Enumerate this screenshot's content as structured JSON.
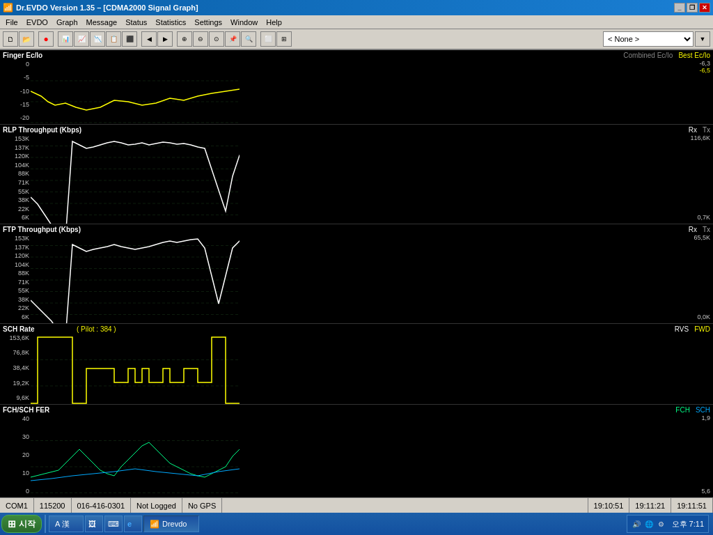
{
  "titleBar": {
    "title": "Dr.EVDO Version 1.35 – [CDMA2000 Signal Graph]",
    "icon": "📶"
  },
  "menuBar": {
    "items": [
      "File",
      "EVDO",
      "Graph",
      "Message",
      "Status",
      "Statistics",
      "Settings",
      "Window",
      "Help"
    ]
  },
  "toolbar": {
    "dropdown": {
      "label": "< None >",
      "options": [
        "< None >"
      ]
    }
  },
  "graphs": [
    {
      "id": "finger-ecio",
      "title": "Finger Ec/Io",
      "rightLabels": [
        "Combined Ec/Io",
        "Best Ec/Io"
      ],
      "yLabels": [
        "0",
        "-5",
        "-10",
        "-15",
        "-20"
      ],
      "topValue": "-6,3",
      "topValue2": "-6,5",
      "color": "#ffff00"
    },
    {
      "id": "rlp-throughput",
      "title": "RLP Throughput (Kbps)",
      "rightLabels": [
        "Rx",
        "Tx"
      ],
      "yLabels": [
        "153K",
        "137K",
        "120K",
        "104K",
        "88K",
        "71K",
        "55K",
        "38K",
        "22K",
        "6K"
      ],
      "topValue": "116,6K",
      "bottomValue": "0,7K",
      "color": "#ffffff"
    },
    {
      "id": "ftp-throughput",
      "title": "FTP Throughput (Kbps)",
      "rightLabels": [
        "Rx",
        "Tx"
      ],
      "yLabels": [
        "153K",
        "137K",
        "120K",
        "104K",
        "88K",
        "71K",
        "55K",
        "38K",
        "22K",
        "6K"
      ],
      "topValue": "65,5K",
      "bottomValue": "0,0K",
      "color": "#ffffff"
    },
    {
      "id": "sch-rate",
      "title": "SCH Rate",
      "subtitle": "( Pilot : 384 )",
      "rightLabels": [
        "RVS",
        "FWD"
      ],
      "yLabels": [
        "153,6K",
        "76,8K",
        "38,4K",
        "19,2K",
        "9,6K"
      ],
      "color": "#ffff00"
    },
    {
      "id": "fch-sch-fer",
      "title": "FCH/SCH FER",
      "rightLabels": [
        "FCH",
        "SCH"
      ],
      "yLabels": [
        "40",
        "30",
        "20",
        "10",
        "0"
      ],
      "topValue": "1,9",
      "bottomValue": "5,6",
      "color": "#00ff88"
    }
  ],
  "statusBar": {
    "items": [
      {
        "label": "COM1",
        "value": "COM1"
      },
      {
        "label": "115200",
        "value": "115200"
      },
      {
        "label": "016-416-0301",
        "value": "016-416-0301"
      },
      {
        "label": "Not Logged",
        "value": "Not Logged"
      },
      {
        "label": "No GPS",
        "value": "No GPS"
      },
      {
        "label": "time1",
        "value": "19:10:51"
      },
      {
        "label": "time2",
        "value": "19:11:21"
      },
      {
        "label": "time3",
        "value": "19:11:51"
      }
    ]
  },
  "taskbar": {
    "startLabel": "시작",
    "inputMethodLabel": "A 漢",
    "activeApp": "Drevdo",
    "time": "오후 7:11"
  }
}
